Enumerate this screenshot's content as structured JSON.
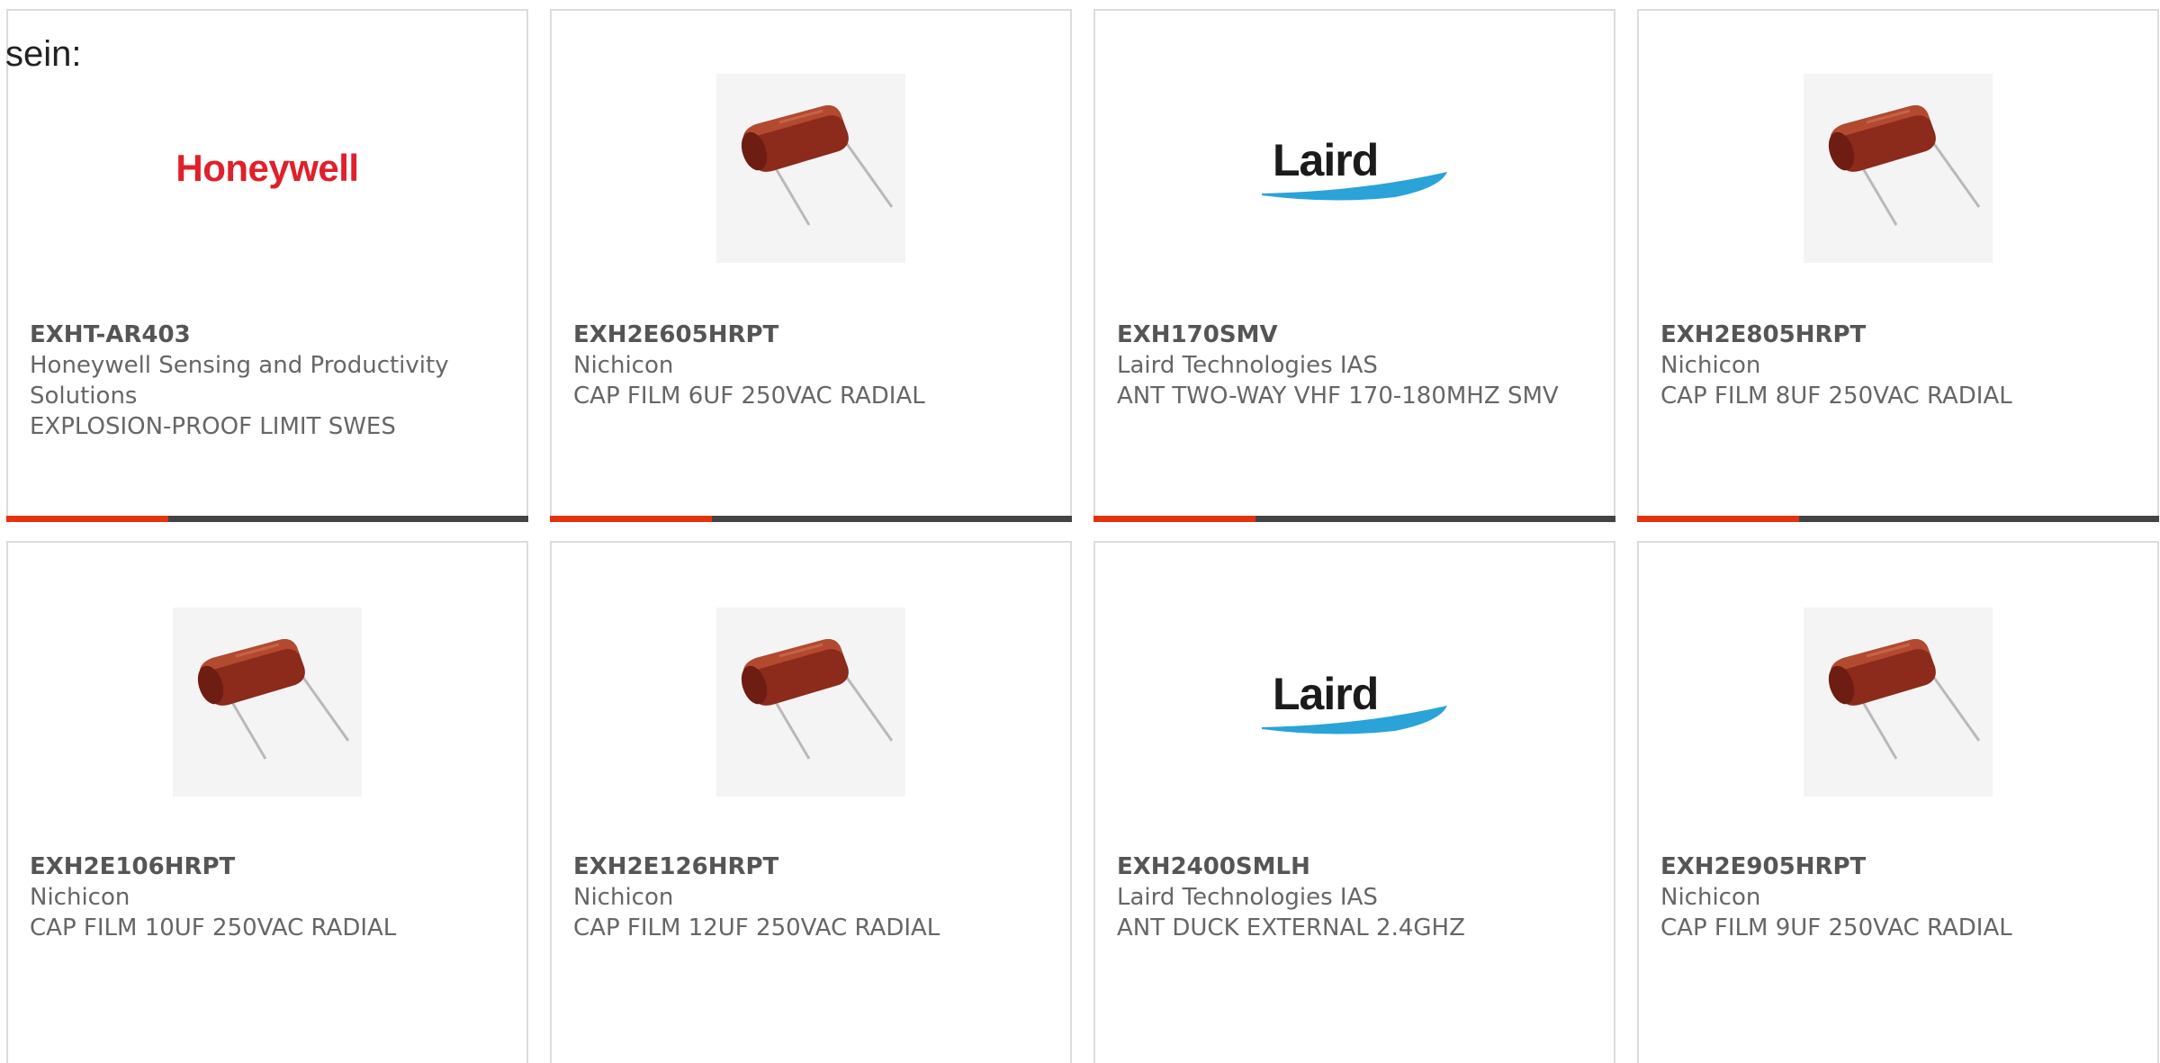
{
  "intro_text": "sein:",
  "colors": {
    "accent": "#e4340f",
    "bar_track": "#444444",
    "card_border": "#dcdcdc",
    "text": "#666666"
  },
  "products": [
    {
      "part": "EXHT-AR403",
      "manufacturer": "Honeywell Sensing and Productivity Solutions",
      "description": "EXPLOSION-PROOF LIMIT SWES",
      "image": "honeywell-logo",
      "logo_text": "Honeywell",
      "progress_pct": 31
    },
    {
      "part": "EXH2E605HRPT",
      "manufacturer": "Nichicon",
      "description": "CAP FILM 6UF 250VAC RADIAL",
      "image": "film-capacitor-photo",
      "progress_pct": 31
    },
    {
      "part": "EXH170SMV",
      "manufacturer": "Laird Technologies IAS",
      "description": "ANT TWO-WAY VHF 170-180MHZ SMV",
      "image": "laird-logo",
      "logo_text": "Laird",
      "progress_pct": 31
    },
    {
      "part": "EXH2E805HRPT",
      "manufacturer": "Nichicon",
      "description": "CAP FILM 8UF 250VAC RADIAL",
      "image": "film-capacitor-photo",
      "progress_pct": 31
    },
    {
      "part": "EXH2E106HRPT",
      "manufacturer": "Nichicon",
      "description": "CAP FILM 10UF 250VAC RADIAL",
      "image": "film-capacitor-photo"
    },
    {
      "part": "EXH2E126HRPT",
      "manufacturer": "Nichicon",
      "description": "CAP FILM 12UF 250VAC RADIAL",
      "image": "film-capacitor-photo"
    },
    {
      "part": "EXH2400SMLH",
      "manufacturer": "Laird Technologies IAS",
      "description": "ANT DUCK EXTERNAL 2.4GHZ",
      "image": "laird-logo",
      "logo_text": "Laird"
    },
    {
      "part": "EXH2E905HRPT",
      "manufacturer": "Nichicon",
      "description": "CAP FILM 9UF 250VAC RADIAL",
      "image": "film-capacitor-photo"
    }
  ]
}
